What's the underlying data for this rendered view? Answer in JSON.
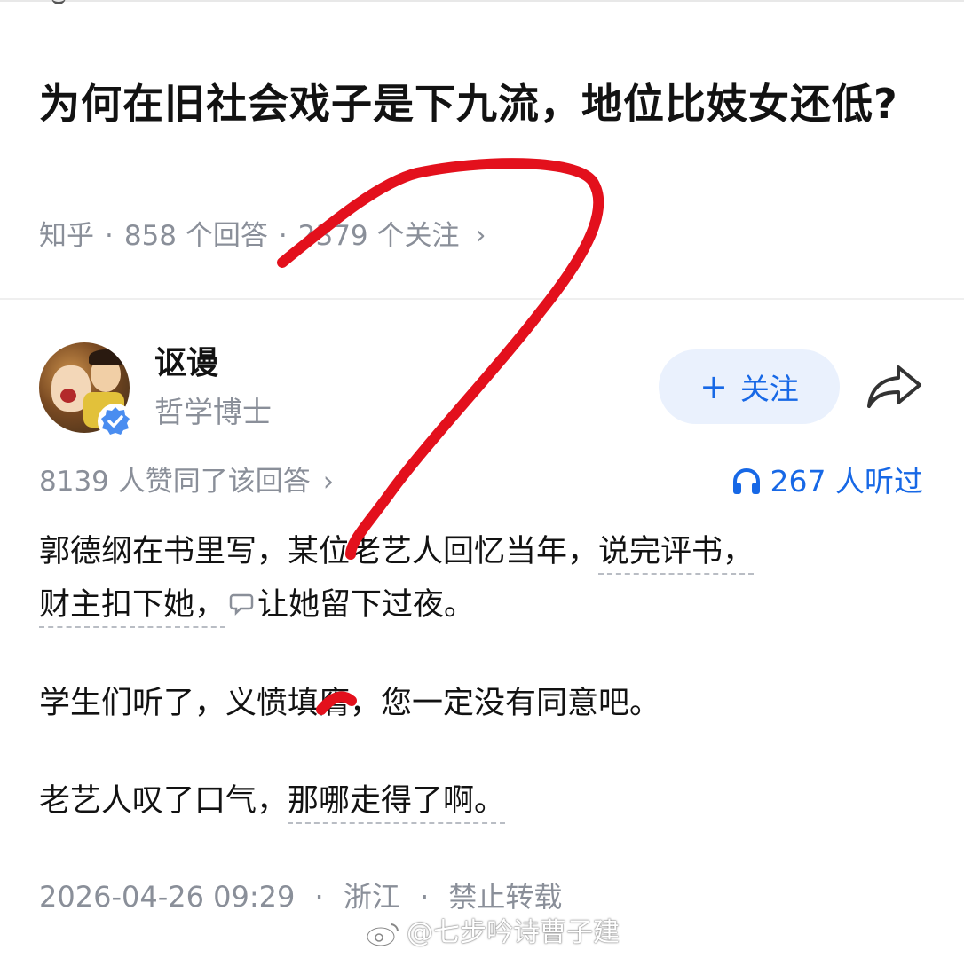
{
  "question": {
    "title": "为何在旧社会戏子是下九流，地位比妓女还低?",
    "source": "知乎",
    "answers": "858 个回答",
    "followers": "2379 个关注",
    "meta_chevron": "›"
  },
  "author": {
    "name": "讴谩",
    "title": "哲学博士",
    "avatar_icon": "cartoon-avatar",
    "verified_icon": "verified-check-icon",
    "follow_plus": "+",
    "follow_label": "关注",
    "share_icon": "share-arrow-icon"
  },
  "stats": {
    "upvotes": "8139 人赞同了该回答",
    "upvotes_chevron": "›",
    "listeners": "267 人听过",
    "listen_icon": "headphones-icon"
  },
  "content": {
    "p1_a": "郭德纲在书里写，某位老艺人回忆当年，",
    "p1_b": "说完评书，",
    "p1_c": "财主扣下她，",
    "p1_d": "让她留下过夜。",
    "p2": "学生们听了，义愤填膺，您一定没有同意吧。",
    "p3_a": "老艺人叹了口气，",
    "p3_b": "那哪走得了啊。"
  },
  "footer": {
    "datetime": "2026-04-26 09:29",
    "location": "浙江",
    "license": "禁止转载",
    "sep": "·"
  },
  "watermark": {
    "text": "@七步吟诗曹子建",
    "icon": "weibo-icon"
  },
  "colors": {
    "accent": "#1768e6",
    "muted": "#8a8f99",
    "annotation_red": "#e3101c"
  }
}
